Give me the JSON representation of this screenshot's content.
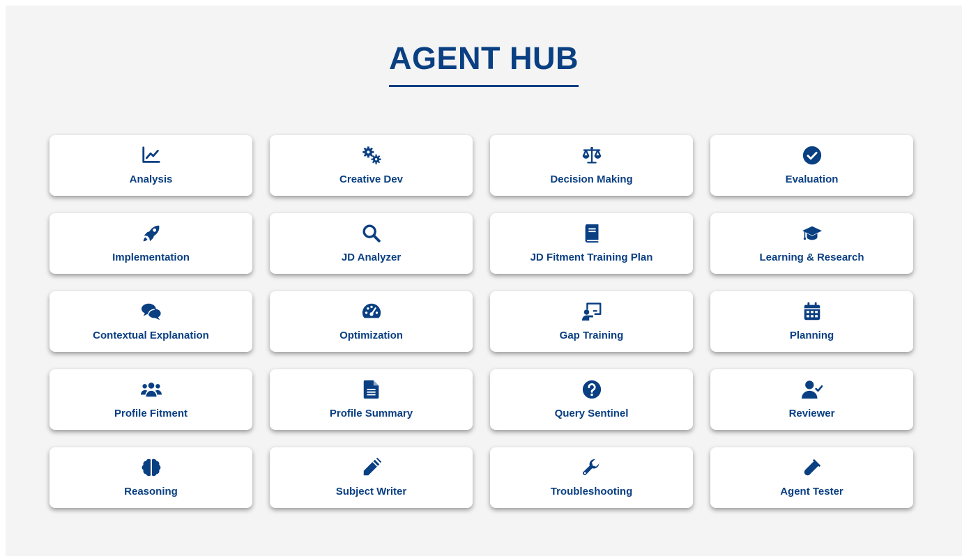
{
  "page": {
    "title": "AGENT HUB"
  },
  "theme": {
    "accent": "#0a3f82",
    "background": "#f4f4f4",
    "card": "#ffffff"
  },
  "agents": [
    {
      "label": "Analysis",
      "icon": "chart-line-icon"
    },
    {
      "label": "Creative Dev",
      "icon": "gears-icon"
    },
    {
      "label": "Decision Making",
      "icon": "scale-balanced-icon"
    },
    {
      "label": "Evaluation",
      "icon": "circle-check-icon"
    },
    {
      "label": "Implementation",
      "icon": "rocket-icon"
    },
    {
      "label": "JD Analyzer",
      "icon": "magnifying-glass-icon"
    },
    {
      "label": "JD Fitment Training Plan",
      "icon": "book-icon"
    },
    {
      "label": "Learning & Research",
      "icon": "graduation-cap-icon"
    },
    {
      "label": "Contextual Explanation",
      "icon": "comments-icon"
    },
    {
      "label": "Optimization",
      "icon": "gauge-icon"
    },
    {
      "label": "Gap Training",
      "icon": "chalkboard-user-icon"
    },
    {
      "label": "Planning",
      "icon": "calendar-icon"
    },
    {
      "label": "Profile Fitment",
      "icon": "users-icon"
    },
    {
      "label": "Profile Summary",
      "icon": "file-lines-icon"
    },
    {
      "label": "Query Sentinel",
      "icon": "circle-question-icon"
    },
    {
      "label": "Reviewer",
      "icon": "user-check-icon"
    },
    {
      "label": "Reasoning",
      "icon": "brain-icon"
    },
    {
      "label": "Subject Writer",
      "icon": "pencil-icon"
    },
    {
      "label": "Troubleshooting",
      "icon": "wrench-icon"
    },
    {
      "label": "Agent Tester",
      "icon": "vial-icon"
    }
  ]
}
